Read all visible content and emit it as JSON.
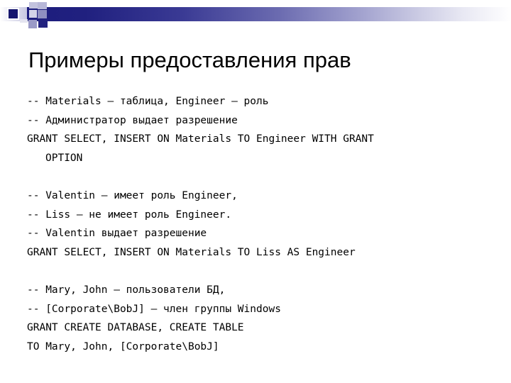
{
  "slide": {
    "title": "Примеры предоставления прав",
    "theme": {
      "accent_navy": "#16166e",
      "accent_bar_start": "#1d1d7e",
      "accent_bar_end": "#ffffff",
      "square_pale": "#c2c2de",
      "square_mid": "#8f8fc0",
      "background": "#ffffff",
      "text_color": "#000000"
    },
    "body_lines": [
      {
        "text": "-- Materials – таблица, Engineer – роль",
        "style": "normal"
      },
      {
        "text": "-- Администратор выдает разрешение",
        "style": "normal"
      },
      {
        "text": "GRANT SELECT, INSERT ON Materials TO Engineer WITH GRANT",
        "style": "normal"
      },
      {
        "text": "OPTION",
        "style": "indent"
      },
      {
        "text": "",
        "style": "blank"
      },
      {
        "text": "-- Valentin – имеет роль Engineer,",
        "style": "normal"
      },
      {
        "text": "-- Liss – не имеет роль Engineer.",
        "style": "normal"
      },
      {
        "text": "-- Valentin выдает разрешение",
        "style": "normal"
      },
      {
        "text": "GRANT SELECT, INSERT ON Materials TO Liss AS Engineer",
        "style": "normal"
      },
      {
        "text": "",
        "style": "blank"
      },
      {
        "text": "-- Mary, John – пользователи БД,",
        "style": "normal"
      },
      {
        "text": "-- [Corporate\\BobJ] – член группы Windows",
        "style": "normal"
      },
      {
        "text": "GRANT CREATE DATABASE, CREATE TABLE",
        "style": "normal"
      },
      {
        "text": "TO Mary, John, [Corporate\\BobJ]",
        "style": "normal"
      }
    ]
  }
}
